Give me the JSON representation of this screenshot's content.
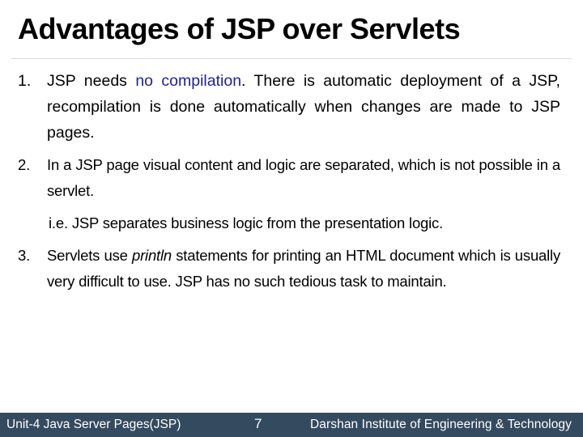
{
  "slide": {
    "title": "Advantages of JSP over Servlets",
    "items": [
      {
        "number": "1.",
        "text_before": "JSP needs ",
        "highlight": "no compilation",
        "text_after": ". There is automatic deployment of a JSP, recompilation is done automatically when changes are made to JSP pages."
      },
      {
        "number": "2.",
        "text": "In a JSP page visual content and logic are separated, which is not possible in a servlet.",
        "note": "i.e.  JSP separates business logic from the presentation logic."
      },
      {
        "number": "3.",
        "text_before": "Servlets use ",
        "emphasis": "println",
        "text_after": " statements for printing an HTML document which is usually very difficult to use. JSP has no such tedious task to maintain."
      }
    ]
  },
  "footer": {
    "unit": "Unit-4 Java Server Pages(JSP)",
    "page_number": "7",
    "institute": "Darshan Institute of Engineering & Technology"
  },
  "colors": {
    "highlight_text": "#1f1f9a",
    "footer_background": "#344a5e",
    "footer_text": "#ffffff"
  }
}
